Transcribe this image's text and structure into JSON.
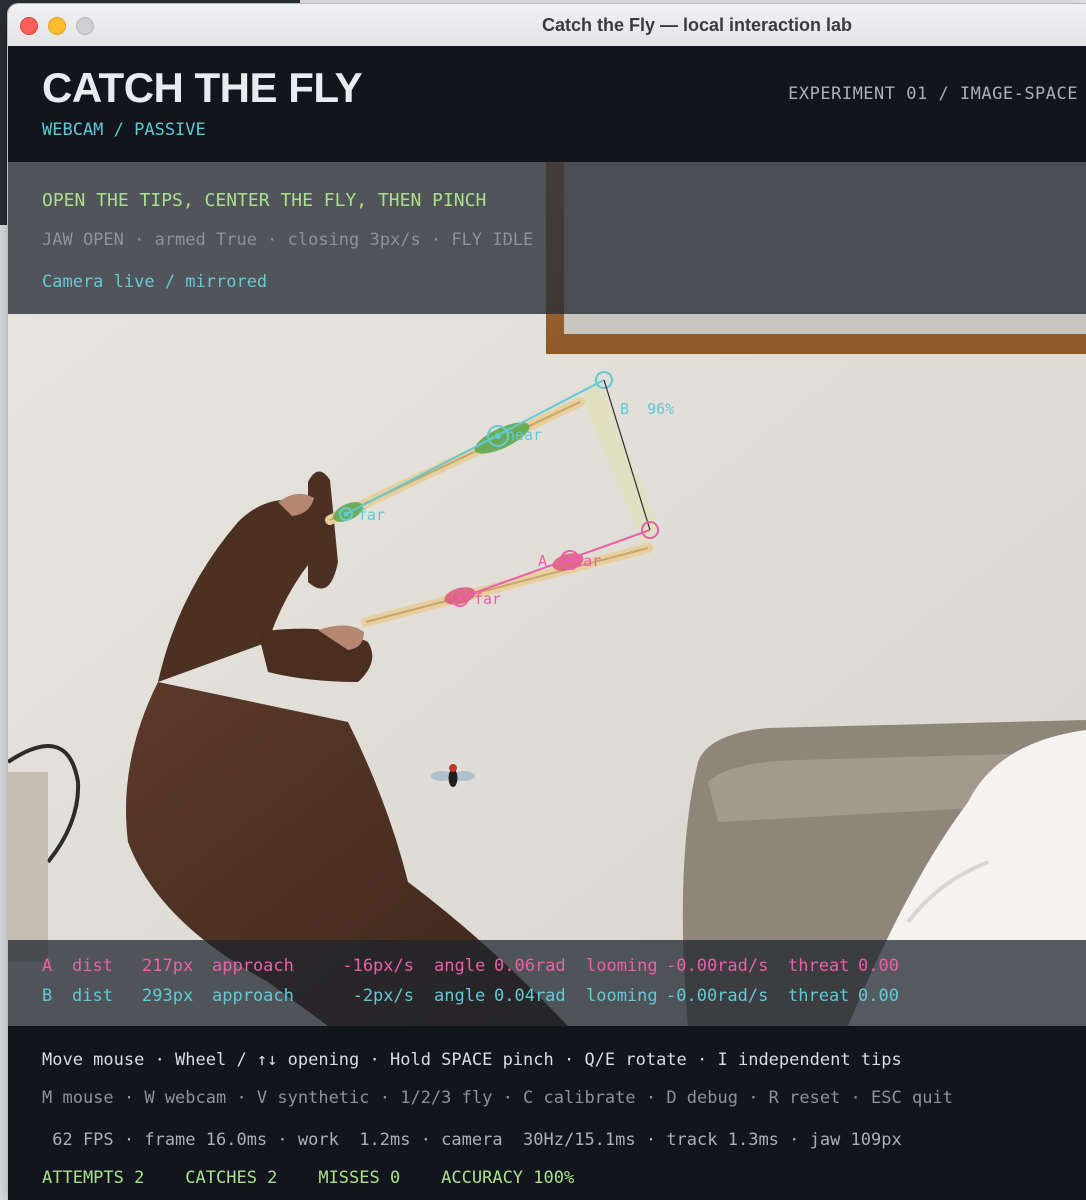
{
  "window": {
    "title": "Catch the Fly — local interaction lab"
  },
  "header": {
    "title": "CATCH THE FLY",
    "subtitle": "WEBCAM / PASSIVE",
    "experiment": "EXPERIMENT 01 / IMAGE-SPACE"
  },
  "overlay": {
    "instruction": "OPEN THE TIPS, CENTER THE FLY, THEN PINCH",
    "status": "JAW OPEN · armed True · closing 3px/s · FLY IDLE",
    "camera": "Camera live / mirrored"
  },
  "tracking_labels": {
    "b_tip": "B  96%",
    "b_near": "near",
    "b_far": "far",
    "a_near": "A  near",
    "a_far": "far"
  },
  "metrics": {
    "a": {
      "id": "A",
      "dist_label": "dist",
      "dist": "217px",
      "approach_label": "approach",
      "approach": "-16px/s",
      "angle_label": "angle",
      "angle": "0.06rad",
      "looming_label": "looming",
      "looming": "-0.00rad/s",
      "threat_label": "threat",
      "threat": "0.00"
    },
    "b": {
      "id": "B",
      "dist_label": "dist",
      "dist": "293px",
      "approach_label": "approach",
      "approach": "-2px/s",
      "angle_label": "angle",
      "angle": "0.04rad",
      "looming_label": "looming",
      "looming": "-0.00rad/s",
      "threat_label": "threat",
      "threat": "0.00"
    }
  },
  "footer": {
    "controls": "Move mouse · Wheel / ↑↓ opening · Hold SPACE pinch · Q/E rotate · I independent tips",
    "keys": "M mouse · W webcam · V synthetic · 1/2/3 fly · C calibrate · D debug · R reset · ESC quit",
    "perf": " 62 FPS · frame 16.0ms · work  1.2ms · camera  30Hz/15.1ms · track 1.3ms · jaw 109px",
    "stats": "ATTEMPTS 2    CATCHES 2    MISSES 0    ACCURACY 100%"
  },
  "colors": {
    "accent_cyan": "#62c9d6",
    "accent_magenta": "#ec5fa9",
    "accent_green": "#a8e08c"
  }
}
